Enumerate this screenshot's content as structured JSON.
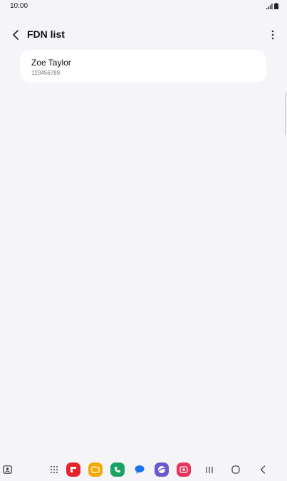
{
  "status_bar": {
    "time": "10:00"
  },
  "app_bar": {
    "title": "FDN list"
  },
  "contacts": [
    {
      "name": "Zoe Taylor",
      "number": "123456789"
    }
  ],
  "icons": {
    "back": "chevron-left-icon",
    "more": "more-vertical-icon",
    "signal": "signal-icon",
    "battery": "battery-icon",
    "edge_panel": "edge-panel-icon",
    "apps": "apps-grid-icon",
    "recents": "recents-icon",
    "home": "home-icon",
    "nav_back": "back-icon"
  },
  "dock_apps": [
    {
      "name": "Flipboard",
      "color": "#e3242b"
    },
    {
      "name": "My Files",
      "color": "#f2a900"
    },
    {
      "name": "Phone",
      "color": "#1aa260"
    },
    {
      "name": "Messages",
      "color": "#1a6ff2"
    },
    {
      "name": "Internet",
      "color": "#6a5acd"
    },
    {
      "name": "Screen recorder",
      "color": "#e8335a"
    }
  ]
}
